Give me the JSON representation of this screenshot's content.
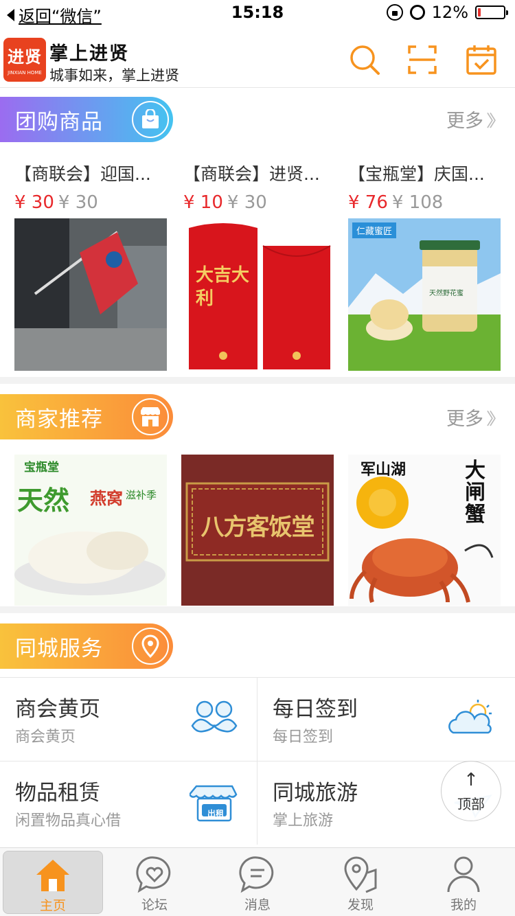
{
  "status_bar": {
    "back_label": "返回“微信”",
    "time": "15:18",
    "battery": "12%",
    "battery_level": 0.12
  },
  "header": {
    "logo_text": "进贤",
    "logo_subtext": "JINXIAN HOME",
    "title": "掌上进贤",
    "slogan": "城事如来，掌上进贤",
    "icons": [
      "search-icon",
      "scan-icon",
      "calendar-check-icon"
    ]
  },
  "group_buy": {
    "title": "团购商品",
    "more": "更多",
    "items": [
      {
        "name": "【商联会】迎国...",
        "price": "¥ 30",
        "orig_price": "¥ 30"
      },
      {
        "name": "【商联会】进贤...",
        "price": "¥ 10",
        "orig_price": "¥ 30"
      },
      {
        "name": "【宝瓶堂】庆国...",
        "price": "¥ 76",
        "orig_price": "¥ 108"
      }
    ],
    "image_texts": [
      "大吉大利",
      "仁藏蜜匠",
      "天然野花蜜"
    ]
  },
  "merchants": {
    "title": "商家推荐",
    "more": "更多",
    "image_texts": [
      "宝瓶堂",
      "天然",
      "燕窝",
      "滋补季",
      "八方客饭堂",
      "军山湖",
      "大闸蟹"
    ]
  },
  "services": {
    "title": "同城服务",
    "items": [
      {
        "title": "商会黄页",
        "subtitle": "商会黄页",
        "icon": "handshake-icon"
      },
      {
        "title": "每日签到",
        "subtitle": "每日签到",
        "icon": "weather-icon"
      },
      {
        "title": "物品租赁",
        "subtitle": "闲置物品真心借",
        "icon": "rent-shop-icon",
        "badge": "出租"
      },
      {
        "title": "同城旅游",
        "subtitle": "掌上旅游",
        "icon": "plane-icon"
      }
    ]
  },
  "back_to_top": "顶部",
  "tabbar": [
    {
      "label": "主页",
      "icon": "home-icon",
      "active": true
    },
    {
      "label": "论坛",
      "icon": "forum-heart-icon"
    },
    {
      "label": "消息",
      "icon": "message-icon"
    },
    {
      "label": "发现",
      "icon": "discover-map-icon"
    },
    {
      "label": "我的",
      "icon": "user-icon"
    }
  ],
  "colors": {
    "accent_orange": "#f7931e",
    "price_red": "#e8282b",
    "group_buy_gradient": [
      "#9b6cf0",
      "#44c3f0"
    ],
    "banner_gradient": [
      "#f9c23c",
      "#fb8c3a"
    ]
  }
}
